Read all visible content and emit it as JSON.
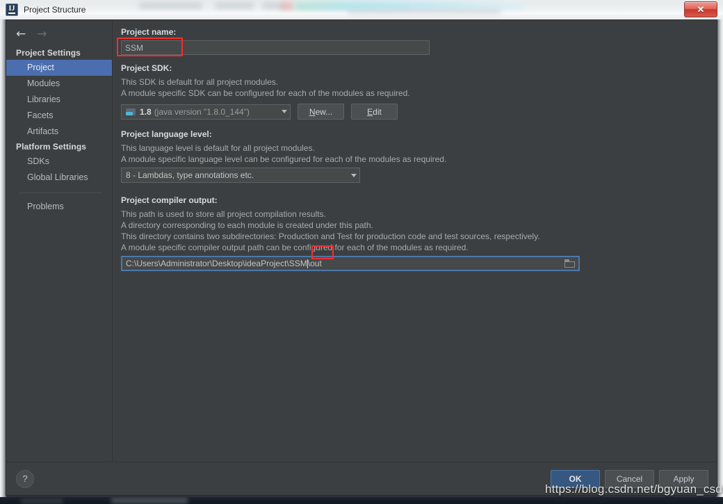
{
  "window": {
    "title": "Project Structure",
    "app_icon": "intellij-idea-icon",
    "close_label": "✕"
  },
  "sidebar": {
    "back_arrow": "←",
    "forward_arrow": "→",
    "groups": [
      {
        "header": "Project Settings",
        "items": [
          {
            "label": "Project",
            "selected": true
          },
          {
            "label": "Modules",
            "selected": false
          },
          {
            "label": "Libraries",
            "selected": false
          },
          {
            "label": "Facets",
            "selected": false
          },
          {
            "label": "Artifacts",
            "selected": false
          }
        ]
      },
      {
        "header": "Platform Settings",
        "items": [
          {
            "label": "SDKs",
            "selected": false
          },
          {
            "label": "Global Libraries",
            "selected": false
          }
        ]
      }
    ],
    "extra_item": "Problems"
  },
  "content": {
    "project_name": {
      "label": "Project name:",
      "value": "SSM",
      "highlighted": true
    },
    "project_sdk": {
      "label": "Project SDK:",
      "desc_lines": [
        "This SDK is default for all project modules.",
        "A module specific SDK can be configured for each of the modules as required."
      ],
      "selected_version": "1.8",
      "selected_detail": "(java version \"1.8.0_144\")",
      "icon": "folder-icon",
      "new_button": {
        "prefix": "",
        "mnemonic": "N",
        "suffix": "ew..."
      },
      "edit_button": {
        "prefix": "",
        "mnemonic": "E",
        "suffix": "dit"
      }
    },
    "language_level": {
      "label": "Project language level:",
      "desc_lines": [
        "This language level is default for all project modules.",
        "A module specific language level can be configured for each of the modules as required."
      ],
      "selected": "8 - Lambdas, type annotations etc."
    },
    "compiler_output": {
      "label": "Project compiler output:",
      "desc_lines": [
        "This path is used to store all project compilation results.",
        "A directory corresponding to each module is created under this path.",
        "This directory contains two subdirectories: Production and Test for production code and test sources, respectively.",
        "A module specific compiler output path can be configured for each of the modules as required."
      ],
      "path_prefix": "C:\\Users\\Administrator\\Desktop\\ideaProject\\",
      "path_highlight": "SSM",
      "path_suffix": "\\out",
      "browse_icon": "folder-browse-icon"
    }
  },
  "footer": {
    "help_label": "?",
    "ok_label": "OK",
    "cancel_label": "Cancel",
    "apply_label": "Apply"
  },
  "watermark": "https://blog.csdn.net/bgyuan_csdn",
  "colors": {
    "bg": "#3c3f41",
    "selection": "#4b6eaf",
    "field_bg": "#45494a",
    "focus_border": "#4b79ab",
    "highlight_red": "#fb2c2c",
    "primary_btn": "#365880"
  }
}
